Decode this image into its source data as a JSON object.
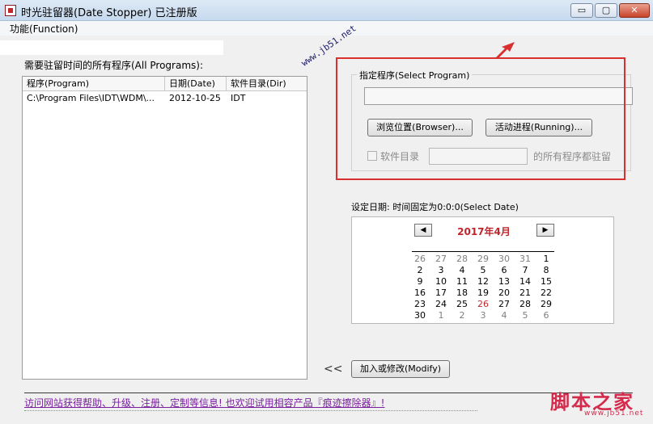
{
  "window": {
    "title": "时光驻留器(Date Stopper) 已注册版",
    "minimize_glyph": "▭",
    "maximize_glyph": "▢",
    "close_glyph": "✕"
  },
  "menu": {
    "function_label": "功能(Function)"
  },
  "left": {
    "all_programs_label": "需要驻留时间的所有程序(All Programs):",
    "columns": [
      "程序(Program)",
      "日期(Date)",
      "软件目录(Dir)"
    ],
    "rows": [
      {
        "program": "C:\\Program Files\\IDT\\WDM\\...",
        "date": "2012-10-25",
        "dir": "IDT"
      }
    ]
  },
  "watermark": "www.jb51.net",
  "select_program": {
    "group_label": "指定程序(Select Program)",
    "path_value": "",
    "browse_label": "浏览位置(Browser)...",
    "running_label": "活动进程(Running)...",
    "dir_checkbox_label": "软件目录",
    "dir_value": "",
    "dir_suffix": "的所有程序都驻留",
    "dir_checked": false
  },
  "date": {
    "label": "设定日期: 时间固定为0:0:0(Select Date)",
    "calendar_title": "2017年4月",
    "prev_glyph": "◀",
    "next_glyph": "▶",
    "weeks": [
      [
        "26",
        "27",
        "28",
        "29",
        "30",
        "31",
        "1"
      ],
      [
        "2",
        "3",
        "4",
        "5",
        "6",
        "7",
        "8"
      ],
      [
        "9",
        "10",
        "11",
        "12",
        "13",
        "14",
        "15"
      ],
      [
        "16",
        "17",
        "18",
        "19",
        "20",
        "21",
        "22"
      ],
      [
        "23",
        "24",
        "25",
        "26",
        "27",
        "28",
        "29"
      ],
      [
        "30",
        "1",
        "2",
        "3",
        "4",
        "5",
        "6"
      ]
    ],
    "today": "26",
    "accent_color": "#c0262b"
  },
  "actions": {
    "collapse_glyph": "<<",
    "modify_label": "加入或修改(Modify)"
  },
  "footer": {
    "promo_text": "访问网站获得帮助、升级、注册、定制等信息! 也欢迎试用相容产品『痕迹擦除器』!",
    "logo_text": "脚本之家",
    "site_url": "www.jb51.net"
  }
}
